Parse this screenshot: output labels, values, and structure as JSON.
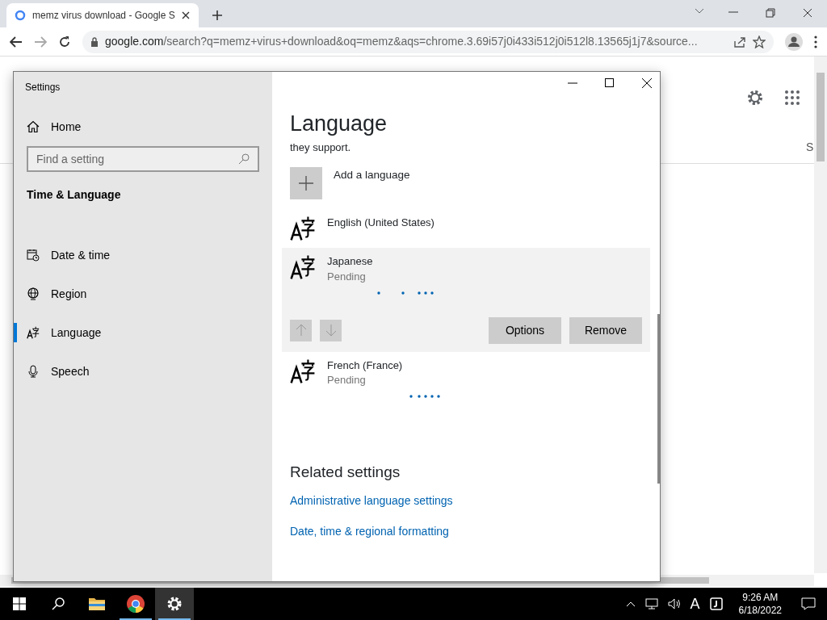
{
  "browser": {
    "tab_title": "memz virus download - Google S",
    "url_host": "google.com",
    "url_rest": "/search?q=memz+virus+download&oq=memz&aqs=chrome.3.69i57j0i433i512j0i512l8.13565j1j7&source...",
    "page_partial_text": "S"
  },
  "settings": {
    "title": "Settings",
    "home": "Home",
    "search": {
      "placeholder": "Find a setting"
    },
    "section": "Time & Language",
    "nav": [
      {
        "label": "Date & time",
        "selected": false
      },
      {
        "label": "Region",
        "selected": false
      },
      {
        "label": "Language",
        "selected": true
      },
      {
        "label": "Speech",
        "selected": false
      }
    ],
    "heading": "Language",
    "description": "they support.",
    "add_label": "Add a language",
    "languages": [
      {
        "name": "English (United States)",
        "expanded": false
      },
      {
        "name": "Japanese",
        "status": "Pending",
        "expanded": true
      },
      {
        "name": "French (France)",
        "status": "Pending",
        "expanded": false
      }
    ],
    "language_buttons": [
      "Options",
      "Remove"
    ],
    "related_heading": "Related settings",
    "related_links": [
      "Administrative language settings",
      "Date, time & regional formatting"
    ]
  },
  "taskbar": {
    "apps": [
      {
        "running": false,
        "selected": false
      },
      {
        "running": true,
        "selected": false
      },
      {
        "running": true,
        "selected": true
      }
    ],
    "tray_input": "A",
    "time": "9:26 AM",
    "date": "6/18/2022"
  }
}
